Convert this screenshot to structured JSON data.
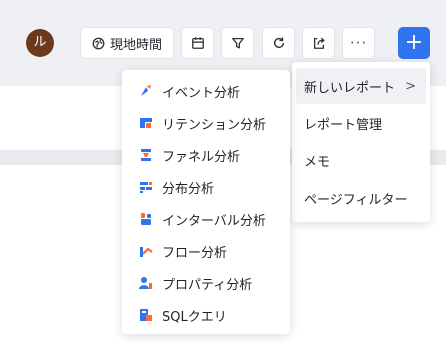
{
  "toolbar": {
    "avatar_initial": "ル",
    "avatar_color": "#6b3a1c",
    "time_label": "現地時間",
    "time_icon": "globe-icon",
    "calendar_icon": "calendar-icon",
    "filter_icon": "filter-icon",
    "refresh_icon": "refresh-icon",
    "share_icon": "share-icon",
    "more_label": "···",
    "add_label": "+",
    "accent_color": "#2f74ee"
  },
  "menu": {
    "items": [
      {
        "label": "新しいレポート",
        "has_submenu": true,
        "chevron": ">"
      },
      {
        "label": "レポート管理"
      },
      {
        "label": "メモ"
      },
      {
        "label": "ページフィルター"
      }
    ]
  },
  "submenu": {
    "items": [
      {
        "label": "イベント分析",
        "icon": "event-analysis-icon"
      },
      {
        "label": "リテンション分析",
        "icon": "retention-analysis-icon"
      },
      {
        "label": "ファネル分析",
        "icon": "funnel-analysis-icon"
      },
      {
        "label": "分布分析",
        "icon": "distribution-analysis-icon"
      },
      {
        "label": "インターバル分析",
        "icon": "interval-analysis-icon"
      },
      {
        "label": "フロー分析",
        "icon": "flow-analysis-icon"
      },
      {
        "label": "プロパティ分析",
        "icon": "property-analysis-icon"
      },
      {
        "label": "SQLクエリ",
        "icon": "sql-query-icon"
      }
    ]
  }
}
